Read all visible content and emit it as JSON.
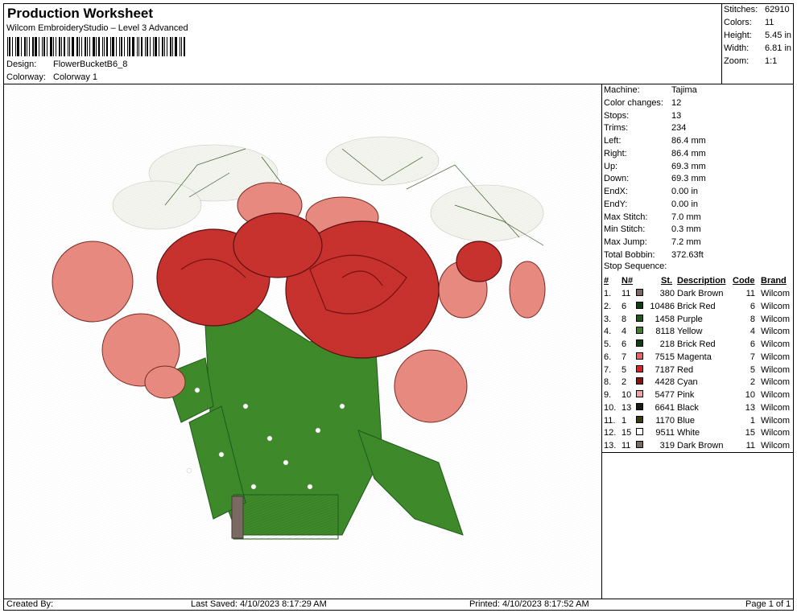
{
  "header": {
    "title": "Production Worksheet",
    "software": "Wilcom EmbroideryStudio – Level 3 Advanced",
    "design_label": "Design:",
    "design_value": "FlowerBucketB6_8",
    "colorway_label": "Colorway:",
    "colorway_value": "Colorway 1"
  },
  "summary": [
    {
      "label": "Stitches:",
      "value": "62910"
    },
    {
      "label": "Colors:",
      "value": "11"
    },
    {
      "label": "Height:",
      "value": "5.45 in"
    },
    {
      "label": "Width:",
      "value": "6.81 in"
    },
    {
      "label": "Zoom:",
      "value": "1:1"
    }
  ],
  "machine_info": [
    {
      "label": "Machine:",
      "value": "Tajima"
    },
    {
      "label": "Color changes:",
      "value": "12"
    },
    {
      "label": "Stops:",
      "value": "13"
    },
    {
      "label": "Trims:",
      "value": "234"
    },
    {
      "label": "Left:",
      "value": "86.4 mm"
    },
    {
      "label": "Right:",
      "value": "86.4 mm"
    },
    {
      "label": "Up:",
      "value": "69.3 mm"
    },
    {
      "label": "Down:",
      "value": "69.3 mm"
    },
    {
      "label": "EndX:",
      "value": "0.00 in"
    },
    {
      "label": "EndY:",
      "value": "0.00 in"
    },
    {
      "label": "Max Stitch:",
      "value": "7.0 mm"
    },
    {
      "label": "Min Stitch:",
      "value": "0.3 mm"
    },
    {
      "label": "Max Jump:",
      "value": "7.2 mm"
    },
    {
      "label": "Total Bobbin:",
      "value": "372.63ft"
    }
  ],
  "stop_sequence": {
    "title": "Stop Sequence:",
    "columns": {
      "num": "#",
      "needle": "N#",
      "stitches": "St.",
      "description": "Description",
      "code": "Code",
      "brand": "Brand"
    },
    "rows": [
      {
        "num": "1.",
        "needle": "11",
        "color": "#7a6a64",
        "stitches": "380",
        "description": "Dark Brown",
        "code": "11",
        "brand": "Wilcom"
      },
      {
        "num": "2.",
        "needle": "6",
        "color": "#0f3d14",
        "stitches": "10486",
        "description": "Brick Red",
        "code": "6",
        "brand": "Wilcom"
      },
      {
        "num": "3.",
        "needle": "8",
        "color": "#1e5a1e",
        "stitches": "1458",
        "description": "Purple",
        "code": "8",
        "brand": "Wilcom"
      },
      {
        "num": "4.",
        "needle": "4",
        "color": "#3f7f2a",
        "stitches": "8118",
        "description": "Yellow",
        "code": "4",
        "brand": "Wilcom"
      },
      {
        "num": "5.",
        "needle": "6",
        "color": "#0f3d14",
        "stitches": "218",
        "description": "Brick Red",
        "code": "6",
        "brand": "Wilcom"
      },
      {
        "num": "6.",
        "needle": "7",
        "color": "#f06060",
        "stitches": "7515",
        "description": "Magenta",
        "code": "7",
        "brand": "Wilcom"
      },
      {
        "num": "7.",
        "needle": "5",
        "color": "#e02020",
        "stitches": "7187",
        "description": "Red",
        "code": "5",
        "brand": "Wilcom"
      },
      {
        "num": "8.",
        "needle": "2",
        "color": "#8b1010",
        "stitches": "4428",
        "description": "Cyan",
        "code": "2",
        "brand": "Wilcom"
      },
      {
        "num": "9.",
        "needle": "10",
        "color": "#f4a0a0",
        "stitches": "5477",
        "description": "Pink",
        "code": "10",
        "brand": "Wilcom"
      },
      {
        "num": "10.",
        "needle": "13",
        "color": "#1a1a10",
        "stitches": "6641",
        "description": "Black",
        "code": "13",
        "brand": "Wilcom"
      },
      {
        "num": "11.",
        "needle": "1",
        "color": "#3a3a0e",
        "stitches": "1170",
        "description": "Blue",
        "code": "1",
        "brand": "Wilcom"
      },
      {
        "num": "12.",
        "needle": "15",
        "color": "#ffffff",
        "stitches": "9511",
        "description": "White",
        "code": "15",
        "brand": "Wilcom"
      },
      {
        "num": "13.",
        "needle": "11",
        "color": "#7a6a64",
        "stitches": "319",
        "description": "Dark Brown",
        "code": "11",
        "brand": "Wilcom"
      }
    ]
  },
  "footer": {
    "created_by": "Created By:",
    "last_saved": "Last Saved: 4/10/2023 8:17:29 AM",
    "printed": "Printed: 4/10/2023 8:17:52 AM",
    "page": "Page 1 of 1"
  },
  "colors": {
    "rose_red": "#c8322e",
    "rose_pink": "#e88a80",
    "leaf_green": "#3e8a2a",
    "dark_green": "#1f5a1a",
    "babys_breath": "#f4f4ee",
    "vase_brown": "#7a6a64"
  }
}
